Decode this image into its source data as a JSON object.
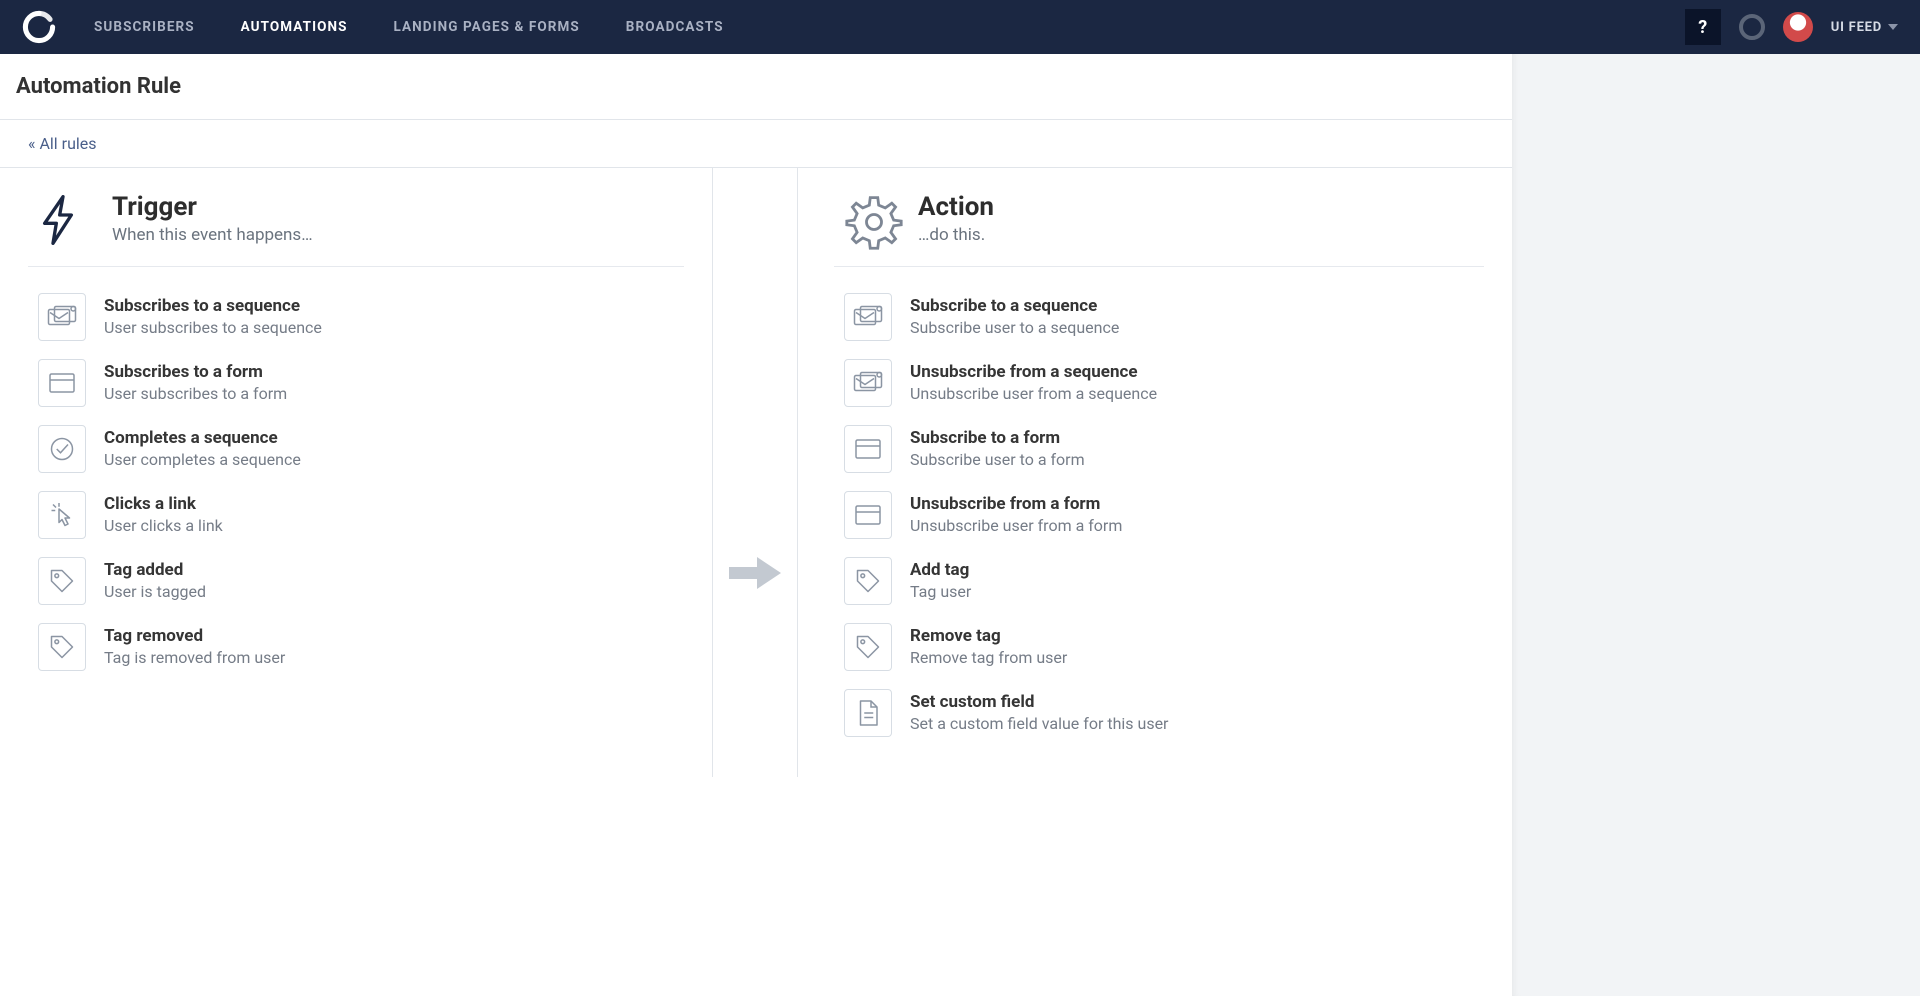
{
  "nav": {
    "items": [
      {
        "label": "SUBSCRIBERS",
        "active": false
      },
      {
        "label": "AUTOMATIONS",
        "active": true
      },
      {
        "label": "LANDING PAGES & FORMS",
        "active": false
      },
      {
        "label": "BROADCASTS",
        "active": false
      }
    ],
    "help": "?",
    "user_label": "UI FEED"
  },
  "page": {
    "title": "Automation Rule",
    "back_link": "« All rules"
  },
  "trigger": {
    "heading": "Trigger",
    "subheading": "When this event happens…",
    "items": [
      {
        "icon": "sequence",
        "title": "Subscribes to a sequence",
        "desc": "User subscribes to a sequence"
      },
      {
        "icon": "form",
        "title": "Subscribes to a form",
        "desc": "User subscribes to a form"
      },
      {
        "icon": "check",
        "title": "Completes a sequence",
        "desc": "User completes a sequence"
      },
      {
        "icon": "click",
        "title": "Clicks a link",
        "desc": "User clicks a link"
      },
      {
        "icon": "tag",
        "title": "Tag added",
        "desc": "User is tagged"
      },
      {
        "icon": "tag",
        "title": "Tag removed",
        "desc": "Tag is removed from user"
      }
    ]
  },
  "action": {
    "heading": "Action",
    "subheading": "…do this.",
    "items": [
      {
        "icon": "sequence",
        "title": "Subscribe to a sequence",
        "desc": "Subscribe user to a sequence"
      },
      {
        "icon": "sequence",
        "title": "Unsubscribe from a sequence",
        "desc": "Unsubscribe user from a sequence"
      },
      {
        "icon": "form",
        "title": "Subscribe to a form",
        "desc": "Subscribe user to a form"
      },
      {
        "icon": "form",
        "title": "Unsubscribe from a form",
        "desc": "Unsubscribe user from a form"
      },
      {
        "icon": "tag",
        "title": "Add tag",
        "desc": "Tag user"
      },
      {
        "icon": "tag",
        "title": "Remove tag",
        "desc": "Remove tag from user"
      },
      {
        "icon": "doc",
        "title": "Set custom field",
        "desc": "Set a custom field value for this user"
      }
    ]
  }
}
